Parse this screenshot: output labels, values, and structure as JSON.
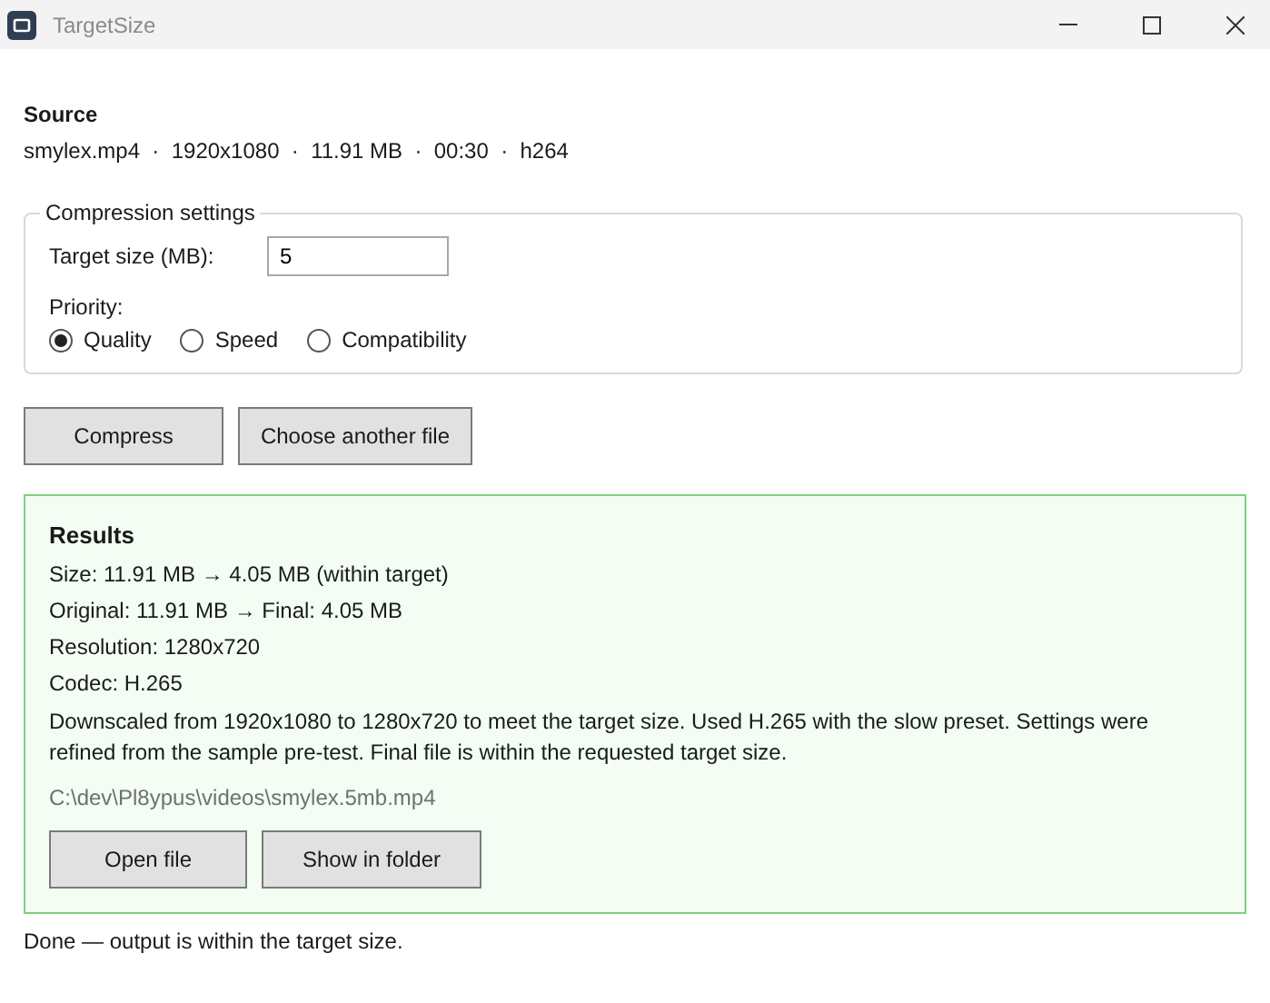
{
  "window": {
    "title": "TargetSize"
  },
  "source": {
    "heading": "Source",
    "details": "smylex.mp4  ·  1920x1080  ·  11.91 MB  ·  00:30  ·  h264"
  },
  "compression_settings": {
    "legend": "Compression settings",
    "target_size_label": "Target size (MB):",
    "target_size_value": "5",
    "priority_label": "Priority:",
    "priority_options": [
      {
        "label": "Quality",
        "selected": true
      },
      {
        "label": "Speed",
        "selected": false
      },
      {
        "label": "Compatibility",
        "selected": false
      }
    ]
  },
  "actions": [
    "Compress",
    "Choose another file"
  ],
  "results": {
    "heading": "Results",
    "lines": [
      "Size: 11.91 MB → 4.05 MB (within target)",
      "Original: 11.91 MB  →  Final: 4.05 MB",
      "Resolution: 1280x720",
      "Codec: H.265"
    ],
    "summary": "Downscaled from 1920x1080 to 1280x720 to meet the target size. Used H.265 with the slow preset. Settings were refined from the sample pre-test. Final file is within the requested target size.",
    "output_path": "C:\\dev\\Pl8ypus\\videos\\smylex.5mb.mp4",
    "buttons": [
      "Open file",
      "Show in folder"
    ]
  },
  "status": "Done — output is within the target size."
}
